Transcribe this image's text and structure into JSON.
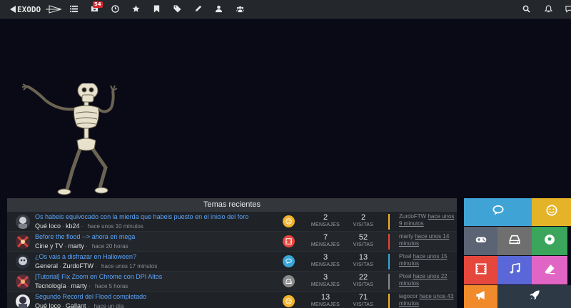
{
  "brand": {
    "logo_text": "EXODO"
  },
  "nav": {
    "notifications_count": "54",
    "icons": [
      "list-icon",
      "inbox-icon",
      "clock-icon",
      "star-icon",
      "bookmark-icon",
      "tags-icon",
      "pen-icon",
      "user-icon",
      "group-icon",
      "search-icon",
      "bell-icon",
      "chat-icon"
    ]
  },
  "topics": {
    "header": "Temas recientes",
    "rows": [
      {
        "title": "Os habeis equivocado con la mierda que habeis puesto en el inicio del foro",
        "category": "Qué loco",
        "author": "kb24",
        "time": "hace unos 10 minutos",
        "messages": "2",
        "messages_label": "MENSAJES",
        "visits": "2",
        "visits_label": "VISITAS",
        "last_user": "ZurdoFTW",
        "last_time": "hace unos 9 minutos",
        "color": "#f2b32a",
        "icon": "smile-icon"
      },
      {
        "title": "Before the flood --> ahora en mega",
        "category": "Cine y TV",
        "author": "marty",
        "time": "hace 20 horas",
        "messages": "7",
        "messages_label": "MENSAJES",
        "visits": "52",
        "visits_label": "VISITAS",
        "last_user": "marty",
        "last_time": "hace unos 14 minutos",
        "color": "#e8473e",
        "icon": "film-icon"
      },
      {
        "title": "¿Os vais a disfrazar en Halloween?",
        "category": "General",
        "author": "ZurdoFTW",
        "time": "hace unos 17 minutos",
        "messages": "3",
        "messages_label": "MENSAJES",
        "visits": "13",
        "visits_label": "VISITAS",
        "last_user": "Pixel",
        "last_time": "hace unos 15 minutos",
        "color": "#3aa6d8",
        "icon": "comments-icon"
      },
      {
        "title": "[Tutorial] Fix Zoom en Chrome con DPI Altos",
        "category": "Tecnología",
        "author": "marty",
        "time": "hace 5 horas",
        "messages": "3",
        "messages_label": "MENSAJES",
        "visits": "22",
        "visits_label": "VISITAS",
        "last_user": "Pixel",
        "last_time": "hace unos 22 minutos",
        "color": "#8a8a8a",
        "icon": "hdd-icon"
      },
      {
        "title": "Segundo Record del Flood completado",
        "category": "Qué loco",
        "author": "Gallant",
        "time": "hace un día",
        "messages": "13",
        "messages_label": "MENSAJES",
        "visits": "71",
        "visits_label": "VISITAS",
        "last_user": "iagocor",
        "last_time": "hace unos 43 minutos",
        "color": "#f2b32a",
        "icon": "smile-icon"
      }
    ]
  },
  "tiles": [
    {
      "icon": "comments-icon",
      "color": "#3fa3d6"
    },
    {
      "icon": "smile-icon",
      "color": "#e5b328"
    },
    {
      "icon": "gamepad-icon",
      "color": "#5b6474"
    },
    {
      "icon": "hdd-icon",
      "color": "#6f6f6f"
    },
    {
      "icon": "soccer-icon",
      "color": "#3aa55b"
    },
    {
      "icon": "film-icon",
      "color": "#e5473d"
    },
    {
      "icon": "music-icon",
      "color": "#5a67d8"
    },
    {
      "icon": "eraser-icon",
      "color": "#e165c4"
    },
    {
      "icon": "bullhorn-icon",
      "color": "#f08a2a"
    },
    {
      "icon": "rocket-icon",
      "color": "#2d3a46"
    }
  ]
}
